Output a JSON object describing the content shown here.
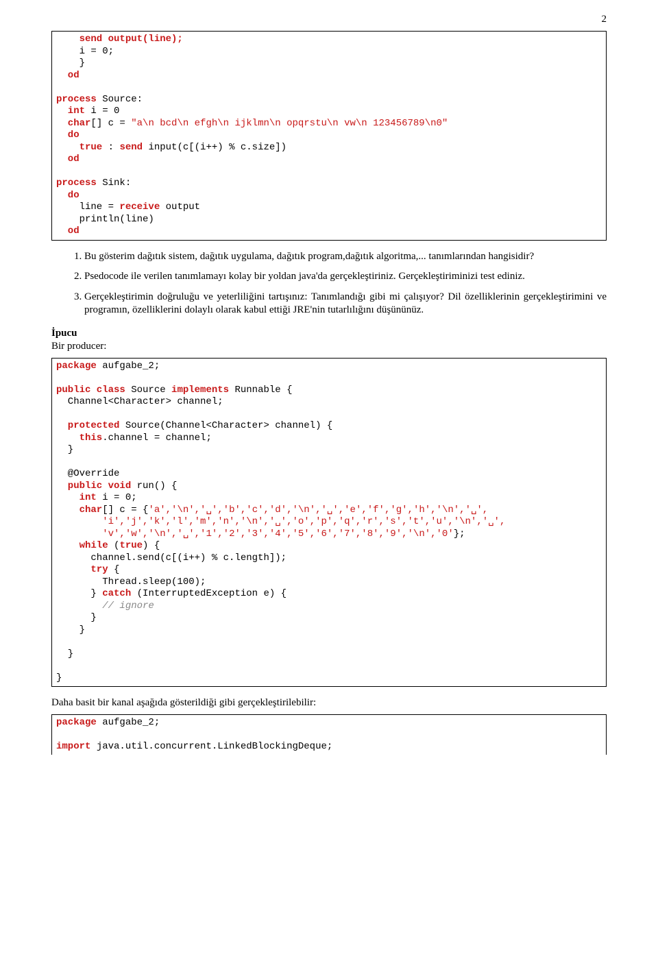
{
  "pageNumber": "2",
  "code1_l1": "    send output(line);",
  "code1_l2": "    i = 0;",
  "code1_l3": "    }",
  "code1_l4": "  od",
  "code1_l5": "",
  "code1_l6_a": "process",
  "code1_l6_b": " Source:",
  "code1_l7_a": "  int",
  "code1_l7_b": " i = 0",
  "code1_l8_a": "  char",
  "code1_l8_b": "[] c = ",
  "code1_l8_c": "\"a\\n bcd\\n efgh\\n ijklmn\\n opqrstu\\n vw\\n 123456789\\n0\"",
  "code1_l9": "  do",
  "code1_l10_a": "    true",
  "code1_l10_b": " : ",
  "code1_l10_c": "send",
  "code1_l10_d": " input(c[(i++) % c.size])",
  "code1_l11": "  od",
  "code1_l12": "",
  "code1_l13_a": "process",
  "code1_l13_b": " Sink:",
  "code1_l14": "  do",
  "code1_l15_a": "    line = ",
  "code1_l15_b": "receive",
  "code1_l15_c": " output",
  "code1_l16": "    println(line)",
  "code1_l17": "  od",
  "q1": "Bu gösterim dağıtık sistem, dağıtık uygulama, dağıtık program,dağıtık algoritma,... tanımlarından hangisidir?",
  "q2": "Psedocode ile verilen tanımlamayı kolay bir yoldan java'da gerçekleştiriniz. Gerçekleştiriminizi test ediniz.",
  "q3": "Gerçekleştirimin doğruluğu ve yeterliliğini tartışınız: Tanımlandığı gibi mi çalışıyor? Dil özelliklerinin gerçekleştirimini ve programın, özelliklerini dolaylı olarak kabul ettiği JRE'nin tutarlılığını düşününüz.",
  "ipucu": "İpucu",
  "birproducer": "Bir producer:",
  "code2_l1_a": "package",
  "code2_l1_b": " aufgabe_2;",
  "code2_l2": "",
  "code2_l3_a": "public class",
  "code2_l3_b": " Source ",
  "code2_l3_c": "implements",
  "code2_l3_d": " Runnable {",
  "code2_l4": "  Channel<Character> channel;",
  "code2_l5": "",
  "code2_l6_a": "  protected",
  "code2_l6_b": " Source(Channel<Character> channel) {",
  "code2_l7_a": "    this",
  "code2_l7_b": ".channel = channel;",
  "code2_l8": "  }",
  "code2_l9": "",
  "code2_l10": "  @Override",
  "code2_l11_a": "  public void",
  "code2_l11_b": " run() {",
  "code2_l12_a": "    int",
  "code2_l12_b": " i = 0;",
  "code2_l13_a": "    char",
  "code2_l13_b": "[] c = {",
  "code2_l13_c": "'a','\\n','␣','b','c','d','\\n','␣','e','f','g','h','\\n','␣',",
  "code2_l14": "        'i','j','k','l','m','n','\\n','␣','o','p','q','r','s','t','u','\\n','␣',",
  "code2_l15": "        'v','w','\\n','␣','1','2','3','4','5','6','7','8','9','\\n','0'",
  "code2_l15b": "};",
  "code2_l16_a": "    while",
  "code2_l16_b": " (",
  "code2_l16_c": "true",
  "code2_l16_d": ") {",
  "code2_l17": "      channel.send(c[(i++) % c.length]);",
  "code2_l18_a": "      try",
  "code2_l18_b": " {",
  "code2_l19": "        Thread.sleep(100);",
  "code2_l20_a": "      } ",
  "code2_l20_b": "catch",
  "code2_l20_c": " (InterruptedException e) {",
  "code2_l21_a": "        ",
  "code2_l21_b": "// ignore",
  "code2_l22": "      }",
  "code2_l23": "    }",
  "code2_l24": "",
  "code2_l25": "  }",
  "code2_l26": "",
  "code2_l27": "}",
  "afterText": "Daha basit bir kanal aşağıda gösterildiği gibi gerçekleştirilebilir:",
  "code3_l1_a": "package",
  "code3_l1_b": " aufgabe_2;",
  "code3_l2": "",
  "code3_l3_a": "import",
  "code3_l3_b": " java.util.concurrent.LinkedBlockingDeque;"
}
